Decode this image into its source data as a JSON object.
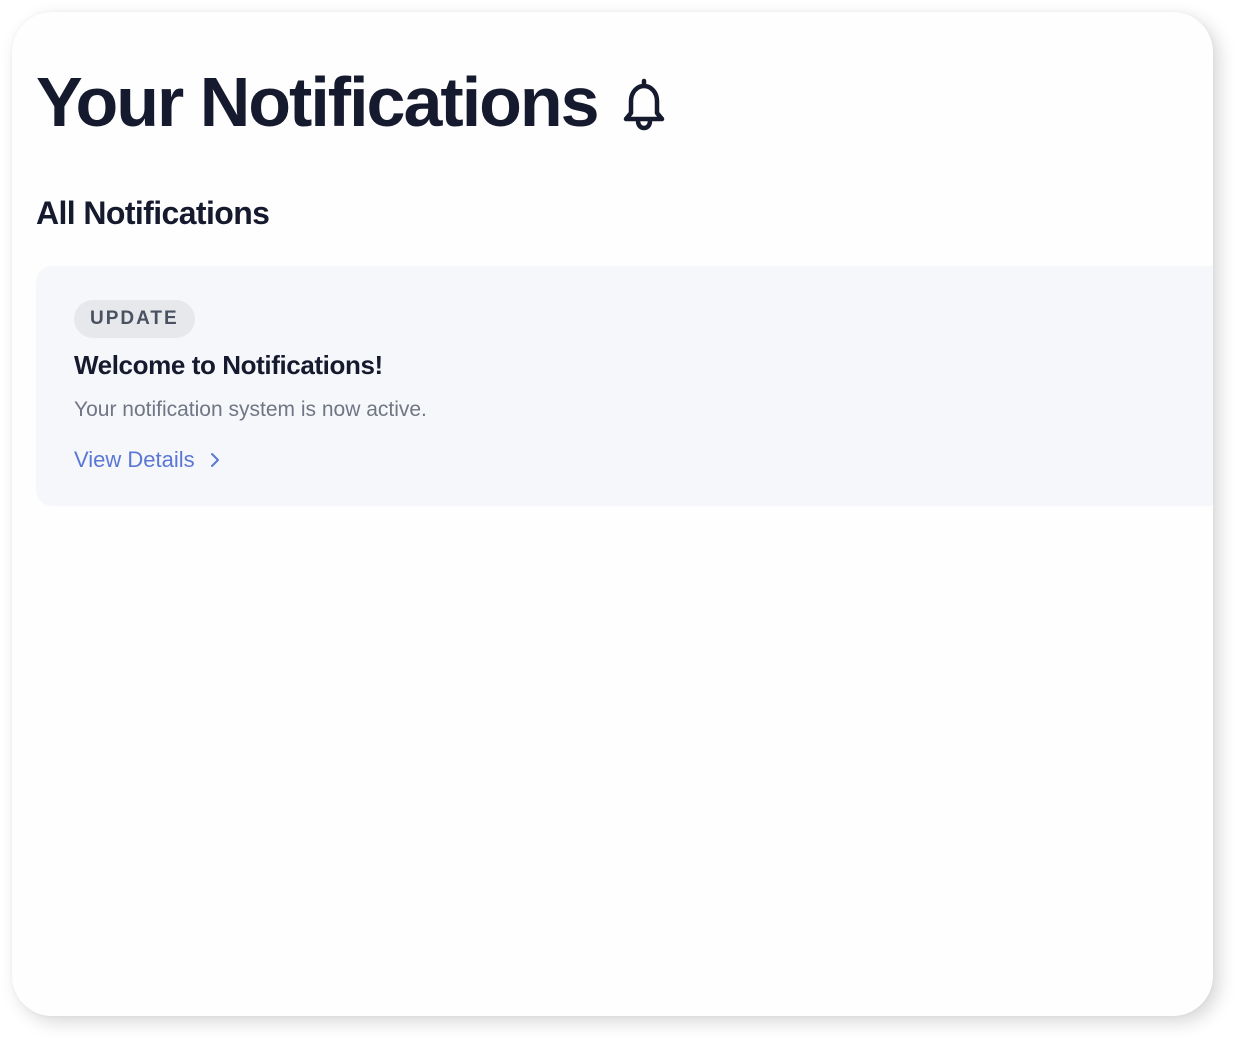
{
  "header": {
    "title": "Your Notifications",
    "title_icon": "bell-icon"
  },
  "section": {
    "title": "All Notifications"
  },
  "notifications": [
    {
      "badge": "UPDATE",
      "title": "Welcome to Notifications!",
      "body": "Your notification system is now active.",
      "link_label": "View Details",
      "link_icon": "chevron-right-icon"
    }
  ],
  "colors": {
    "heading": "#161a2e",
    "link": "#5b77d6",
    "card_background": "#f6f7fa",
    "badge_background": "#e6e8ec",
    "muted_text": "#707684"
  }
}
